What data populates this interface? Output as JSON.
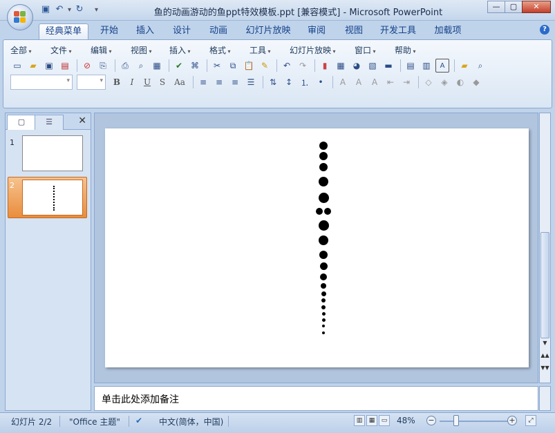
{
  "window": {
    "title": "鱼的动画游动的鱼ppt特效模板.ppt [兼容模式] - Microsoft PowerPoint",
    "minimize": "—",
    "maximize": "▢",
    "close": "✕"
  },
  "qat": {
    "save": "💾",
    "undo": "↶",
    "redo": "↻",
    "more": "▾"
  },
  "tabs": [
    "经典菜单",
    "开始",
    "插入",
    "设计",
    "动画",
    "幻灯片放映",
    "审阅",
    "视图",
    "开发工具",
    "加载项"
  ],
  "help": "?",
  "menus": [
    "全部",
    "文件",
    "编辑",
    "视图",
    "插入",
    "格式",
    "工具",
    "幻灯片放映",
    "窗口",
    "帮助"
  ],
  "format_buttons": [
    "B",
    "I",
    "U",
    "S",
    "Aa"
  ],
  "panel": {
    "close": "✕",
    "slides": [
      {
        "num": "1"
      },
      {
        "num": "2"
      }
    ]
  },
  "notes": {
    "placeholder": "单击此处添加备注"
  },
  "status": {
    "slide": "幻灯片 2/2",
    "theme": "\"Office 主题\"",
    "lang": "中文(简体，中国)",
    "zoom": "48%",
    "zoom_level": 0.48
  }
}
